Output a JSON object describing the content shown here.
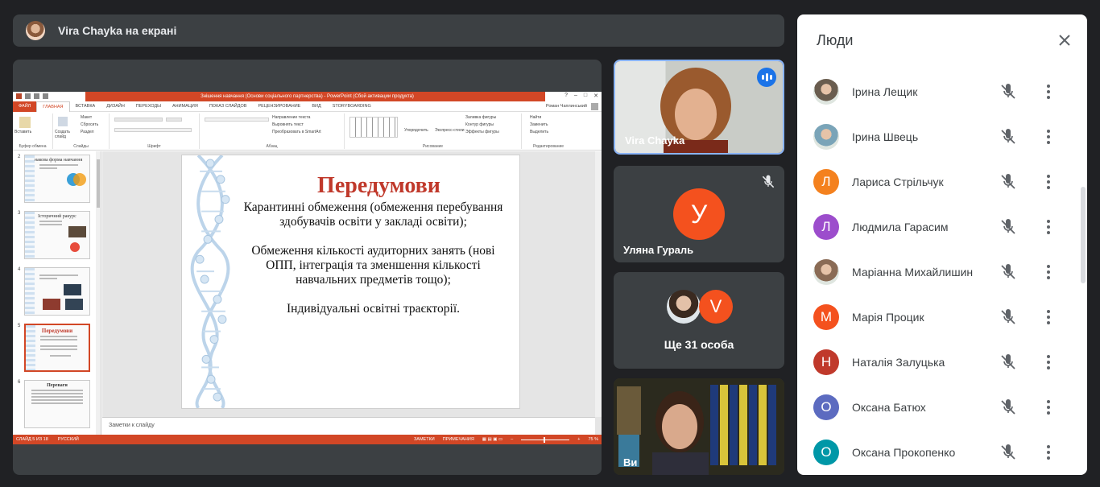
{
  "presenting": {
    "title": "Vira Chayka на екрані"
  },
  "powerpoint": {
    "window_title": "Знішення навчання (Основи соціального партнерства) - PowerPoint (Сбой активации продукта)",
    "window_controls": [
      "?",
      "–",
      "□",
      "✕"
    ],
    "tabs": [
      {
        "label": "ФАЙЛ",
        "kind": "file"
      },
      {
        "label": "ГЛАВНАЯ",
        "kind": "active"
      },
      {
        "label": "ВСТАВКА",
        "kind": "normal"
      },
      {
        "label": "ДИЗАЙН",
        "kind": "normal"
      },
      {
        "label": "ПЕРЕХОДЫ",
        "kind": "normal"
      },
      {
        "label": "АНИМАЦИЯ",
        "kind": "normal"
      },
      {
        "label": "ПОКАЗ СЛАЙДОВ",
        "kind": "normal"
      },
      {
        "label": "РЕЦЕНЗИРОВАНИЕ",
        "kind": "normal"
      },
      {
        "label": "ВИД",
        "kind": "normal"
      },
      {
        "label": "STORYBOARDING",
        "kind": "normal"
      }
    ],
    "user": "Роман Чаплинський",
    "ribbon": {
      "paste": "Вставить",
      "create_slide": "Создать слайд",
      "layout": "Макет",
      "reset": "Сбросить",
      "section": "Раздел",
      "text_direction": "Направление текста",
      "align_text": "Выровнять текст",
      "smartart": "Преобразовать в SmartArt",
      "arrange": "Упорядочить",
      "quick_styles": "Экспресс-стили",
      "shape_fill": "Заливка фигуры",
      "shape_outline": "Контур фигуры",
      "shape_effects": "Эффекты фигуры",
      "find": "Найти",
      "replace": "Заменить",
      "select": "Выделить",
      "groups": {
        "clipboard": "Буфер обмена",
        "slides": "Слайды",
        "font": "Шрифт",
        "paragraph": "Абзац",
        "drawing": "Рисование",
        "editing": "Редактирование"
      }
    },
    "thumbnails": [
      {
        "num": "2",
        "title": "Знакова форма навчання"
      },
      {
        "num": "3",
        "title": "Історичний ракурс"
      },
      {
        "num": "4",
        "title": ""
      },
      {
        "num": "5",
        "title": "Передумови"
      },
      {
        "num": "6",
        "title": "Переваги"
      }
    ],
    "slide": {
      "title": "Передумови",
      "paragraphs": [
        "Карантинні обмеження (обмеження перебування здобувачів освіти у закладі освіти);",
        "Обмеження кількості аудиторних занять (нові ОПП, інтеграція та зменшення кількості навчальних предметів тощо);",
        "Індивідуальні освітні траєкторії."
      ]
    },
    "notes_placeholder": "Заметки к слайду",
    "status": {
      "slide_counter": "СЛАЙД 5 ИЗ 18",
      "language": "РУССКИЙ",
      "notes": "ЗАМЕТКИ",
      "comments": "ПРИМЕЧАНИЯ",
      "zoom": "75 %"
    }
  },
  "tiles": {
    "vira": {
      "name": "Vira Chayka"
    },
    "ulyana": {
      "name": "Уляна Гураль",
      "initial": "У",
      "color": "#f4511e"
    },
    "more": {
      "label": "Ще 31 особа",
      "initial": "V",
      "color": "#f4511e"
    },
    "last": {
      "name": "Ви"
    }
  },
  "people": {
    "title": "Люди",
    "list": [
      {
        "name": "Ірина Лещик",
        "initial": "",
        "color": "#6a5d4f",
        "photo": true
      },
      {
        "name": "Ірина Швець",
        "initial": "",
        "color": "#7aa4b8",
        "photo": true
      },
      {
        "name": "Лариса Стрільчук",
        "initial": "Л",
        "color": "#f4811e",
        "photo": false
      },
      {
        "name": "Людмила Гарасим",
        "initial": "Л",
        "color": "#9c4dcc",
        "photo": false
      },
      {
        "name": "Маріанна Михайлишин",
        "initial": "",
        "color": "#8a6b55",
        "photo": true
      },
      {
        "name": "Марія Процик",
        "initial": "М",
        "color": "#f4511e",
        "photo": false
      },
      {
        "name": "Наталія Залуцька",
        "initial": "Н",
        "color": "#c0392b",
        "photo": false
      },
      {
        "name": "Оксана Батюх",
        "initial": "О",
        "color": "#5c6bc0",
        "photo": false
      },
      {
        "name": "Оксана Прокопенко",
        "initial": "О",
        "color": "#0097a7",
        "photo": false
      }
    ]
  }
}
